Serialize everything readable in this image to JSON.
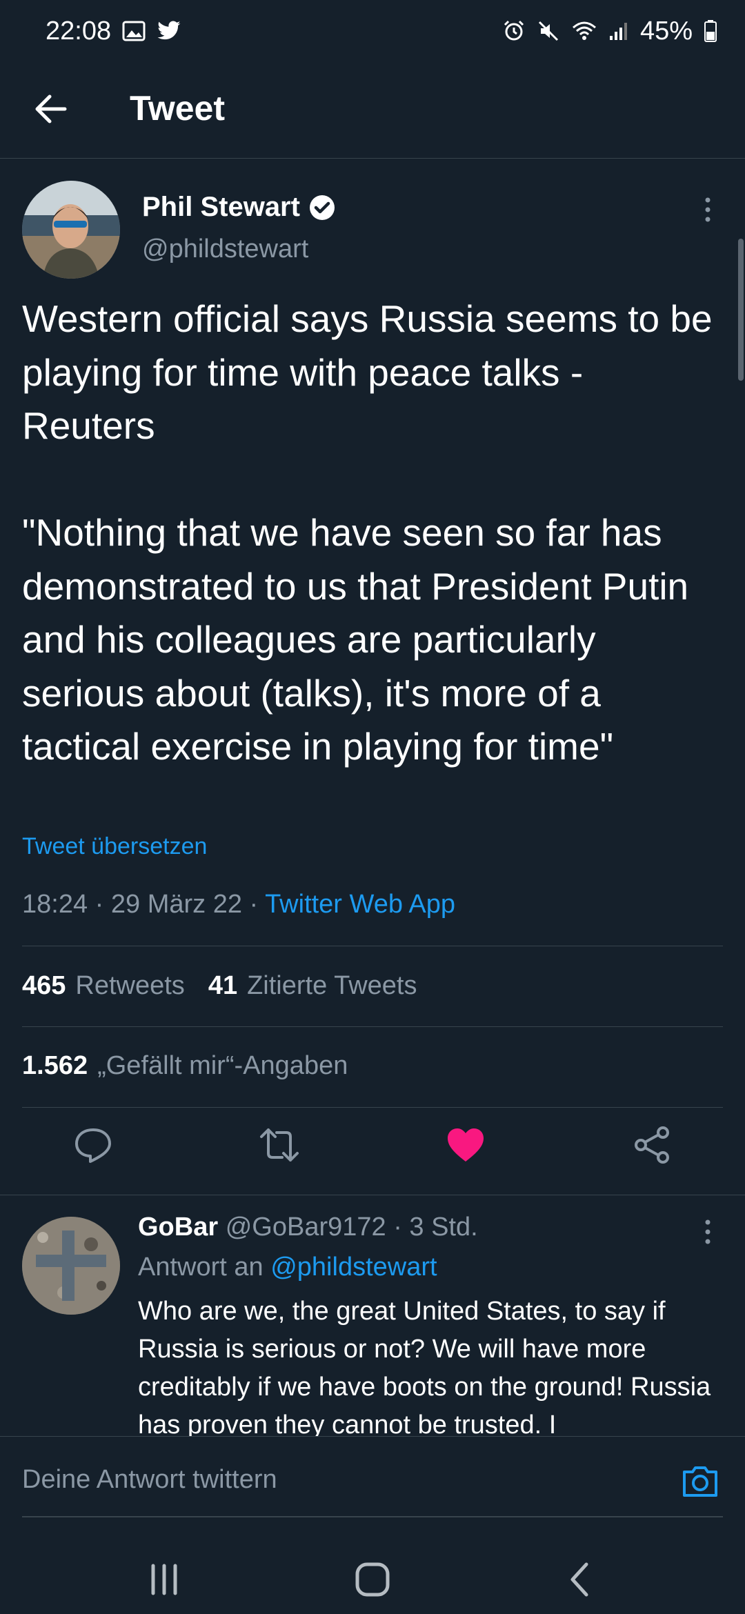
{
  "status_bar": {
    "time": "22:08",
    "battery": "45%",
    "icons_left": [
      "gallery-icon",
      "twitter-icon"
    ],
    "icons_right": [
      "alarm-icon",
      "mute-icon",
      "wifi-icon",
      "signal-icon",
      "battery-icon"
    ]
  },
  "header": {
    "title": "Tweet"
  },
  "tweet": {
    "author_name": "Phil Stewart",
    "author_handle": "@phildstewart",
    "text": "Western official says Russia seems to be playing for time with peace talks - Reuters\n\n\"Nothing that we have seen so far has demonstrated to us that President Putin and his colleagues are particularly serious about (talks), it's more of a tactical exercise in playing for time\"",
    "translate_label": "Tweet übersetzen",
    "time": "18:24",
    "date": "29 März 22",
    "app": "Twitter Web App",
    "retweets_count": "465",
    "retweets_label": "Retweets",
    "quotes_count": "41",
    "quotes_label": "Zitierte Tweets",
    "likes_count": "1.562",
    "likes_label": "„Gefällt mir“-Angaben",
    "liked": true
  },
  "reply": {
    "name": "GoBar",
    "handle": "@GoBar9172",
    "age": "3 Std.",
    "reply_to_label": "Antwort an",
    "reply_to_handle": "@phildstewart",
    "text": "Who are we, the great United States, to say if Russia is serious or not? We will have more creditably if we have boots on the ground! Russia has proven they cannot be trusted. I"
  },
  "compose": {
    "placeholder": "Deine Antwort twittern"
  },
  "colors": {
    "background": "#15202b",
    "accent": "#1d9bf0",
    "like": "#f91880",
    "muted": "#8b98a5",
    "divider": "#38444d"
  }
}
